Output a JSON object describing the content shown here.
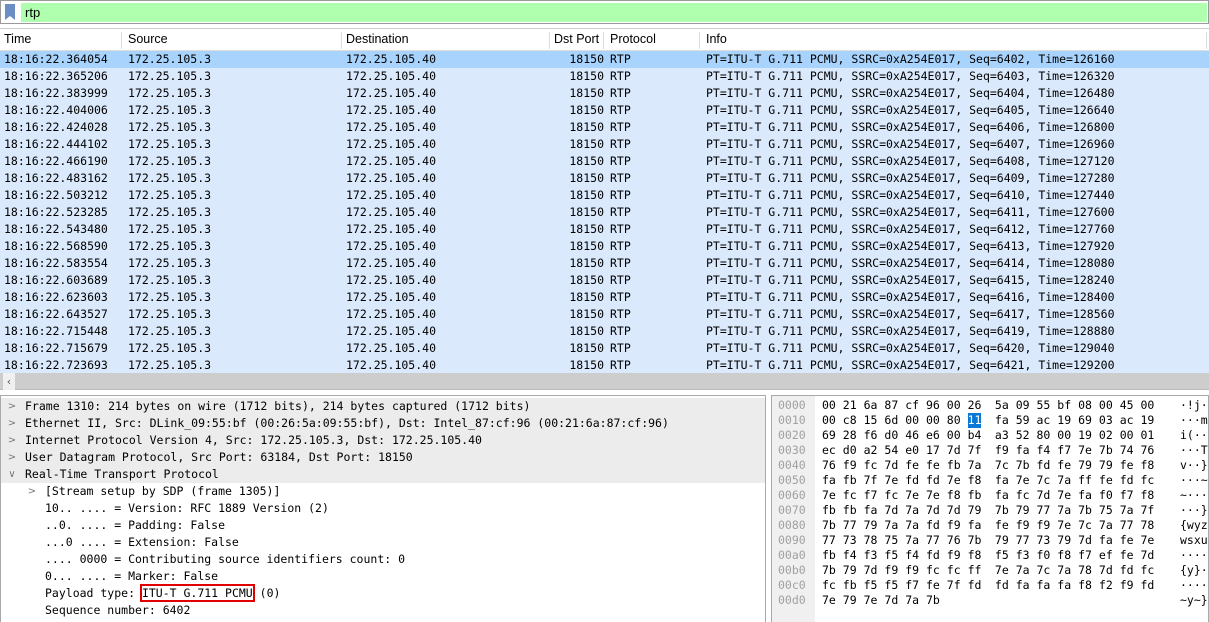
{
  "filter": {
    "value": "rtp"
  },
  "columns": [
    "Time",
    "Source",
    "Destination",
    "Dst Port",
    "Protocol",
    "Info"
  ],
  "packets": [
    [
      "18:16:22.364054",
      "172.25.105.3",
      "172.25.105.40",
      "18150",
      "RTP",
      "PT=ITU-T G.711 PCMU, SSRC=0xA254E017, Seq=6402, Time=126160"
    ],
    [
      "18:16:22.365206",
      "172.25.105.3",
      "172.25.105.40",
      "18150",
      "RTP",
      "PT=ITU-T G.711 PCMU, SSRC=0xA254E017, Seq=6403, Time=126320"
    ],
    [
      "18:16:22.383999",
      "172.25.105.3",
      "172.25.105.40",
      "18150",
      "RTP",
      "PT=ITU-T G.711 PCMU, SSRC=0xA254E017, Seq=6404, Time=126480"
    ],
    [
      "18:16:22.404006",
      "172.25.105.3",
      "172.25.105.40",
      "18150",
      "RTP",
      "PT=ITU-T G.711 PCMU, SSRC=0xA254E017, Seq=6405, Time=126640"
    ],
    [
      "18:16:22.424028",
      "172.25.105.3",
      "172.25.105.40",
      "18150",
      "RTP",
      "PT=ITU-T G.711 PCMU, SSRC=0xA254E017, Seq=6406, Time=126800"
    ],
    [
      "18:16:22.444102",
      "172.25.105.3",
      "172.25.105.40",
      "18150",
      "RTP",
      "PT=ITU-T G.711 PCMU, SSRC=0xA254E017, Seq=6407, Time=126960"
    ],
    [
      "18:16:22.466190",
      "172.25.105.3",
      "172.25.105.40",
      "18150",
      "RTP",
      "PT=ITU-T G.711 PCMU, SSRC=0xA254E017, Seq=6408, Time=127120"
    ],
    [
      "18:16:22.483162",
      "172.25.105.3",
      "172.25.105.40",
      "18150",
      "RTP",
      "PT=ITU-T G.711 PCMU, SSRC=0xA254E017, Seq=6409, Time=127280"
    ],
    [
      "18:16:22.503212",
      "172.25.105.3",
      "172.25.105.40",
      "18150",
      "RTP",
      "PT=ITU-T G.711 PCMU, SSRC=0xA254E017, Seq=6410, Time=127440"
    ],
    [
      "18:16:22.523285",
      "172.25.105.3",
      "172.25.105.40",
      "18150",
      "RTP",
      "PT=ITU-T G.711 PCMU, SSRC=0xA254E017, Seq=6411, Time=127600"
    ],
    [
      "18:16:22.543480",
      "172.25.105.3",
      "172.25.105.40",
      "18150",
      "RTP",
      "PT=ITU-T G.711 PCMU, SSRC=0xA254E017, Seq=6412, Time=127760"
    ],
    [
      "18:16:22.568590",
      "172.25.105.3",
      "172.25.105.40",
      "18150",
      "RTP",
      "PT=ITU-T G.711 PCMU, SSRC=0xA254E017, Seq=6413, Time=127920"
    ],
    [
      "18:16:22.583554",
      "172.25.105.3",
      "172.25.105.40",
      "18150",
      "RTP",
      "PT=ITU-T G.711 PCMU, SSRC=0xA254E017, Seq=6414, Time=128080"
    ],
    [
      "18:16:22.603689",
      "172.25.105.3",
      "172.25.105.40",
      "18150",
      "RTP",
      "PT=ITU-T G.711 PCMU, SSRC=0xA254E017, Seq=6415, Time=128240"
    ],
    [
      "18:16:22.623603",
      "172.25.105.3",
      "172.25.105.40",
      "18150",
      "RTP",
      "PT=ITU-T G.711 PCMU, SSRC=0xA254E017, Seq=6416, Time=128400"
    ],
    [
      "18:16:22.643527",
      "172.25.105.3",
      "172.25.105.40",
      "18150",
      "RTP",
      "PT=ITU-T G.711 PCMU, SSRC=0xA254E017, Seq=6417, Time=128560"
    ],
    [
      "18:16:22.715448",
      "172.25.105.3",
      "172.25.105.40",
      "18150",
      "RTP",
      "PT=ITU-T G.711 PCMU, SSRC=0xA254E017, Seq=6419, Time=128880"
    ],
    [
      "18:16:22.715679",
      "172.25.105.3",
      "172.25.105.40",
      "18150",
      "RTP",
      "PT=ITU-T G.711 PCMU, SSRC=0xA254E017, Seq=6420, Time=129040"
    ],
    [
      "18:16:22.723693",
      "172.25.105.3",
      "172.25.105.40",
      "18150",
      "RTP",
      "PT=ITU-T G.711 PCMU, SSRC=0xA254E017, Seq=6421, Time=129200"
    ]
  ],
  "selected_packet": 0,
  "details": [
    {
      "level": 0,
      "toggle": "collapsed",
      "text": "Frame 1310: 214 bytes on wire (1712 bits), 214 bytes captured (1712 bits)"
    },
    {
      "level": 0,
      "toggle": "collapsed",
      "text": "Ethernet II, Src: DLink_09:55:bf (00:26:5a:09:55:bf), Dst: Intel_87:cf:96 (00:21:6a:87:cf:96)"
    },
    {
      "level": 0,
      "toggle": "collapsed",
      "text": "Internet Protocol Version 4, Src: 172.25.105.3, Dst: 172.25.105.40"
    },
    {
      "level": 0,
      "toggle": "collapsed",
      "text": "User Datagram Protocol, Src Port: 63184, Dst Port: 18150"
    },
    {
      "level": 0,
      "toggle": "expanded",
      "text": "Real-Time Transport Protocol"
    },
    {
      "level": 1,
      "toggle": "collapsed",
      "text": "[Stream setup by SDP (frame 1305)]"
    },
    {
      "level": 1,
      "toggle": "",
      "text": "10.. .... = Version: RFC 1889 Version (2)"
    },
    {
      "level": 1,
      "toggle": "",
      "text": "..0. .... = Padding: False"
    },
    {
      "level": 1,
      "toggle": "",
      "text": "...0 .... = Extension: False"
    },
    {
      "level": 1,
      "toggle": "",
      "text": ".... 0000 = Contributing source identifiers count: 0"
    },
    {
      "level": 1,
      "toggle": "",
      "text": "0... .... = Marker: False"
    },
    {
      "level": 1,
      "toggle": "",
      "text": "Payload type: ",
      "highlight": "ITU-T G.711 PCMU",
      "after": " (0)"
    },
    {
      "level": 1,
      "toggle": "",
      "text": "Sequence number: 6402"
    }
  ],
  "hex": [
    {
      "offset": "0000",
      "bytes": "00 21 6a 87 cf 96 00 26 5a 09 55 bf 08 00 45 00",
      "ascii": "·!j··"
    },
    {
      "offset": "0010",
      "bytes": "00 c8 15 6d 00 00 80 11 fa 59 ac 19 69 03 ac 19",
      "ascii": "···m·"
    },
    {
      "offset": "0020",
      "bytes": "69 28 f6 d0 46 e6 00 b4 a3 52 80 00 19 02 00 01",
      "ascii": "i(··F"
    },
    {
      "offset": "0030",
      "bytes": "ec d0 a2 54 e0 17 7d 7f f9 fa f4 f7 7e 7b 74 76",
      "ascii": "···T·"
    },
    {
      "offset": "0040",
      "bytes": "76 f9 fc 7d fe fe fb 7a 7c 7b fd fe 79 79 fe f8",
      "ascii": "v··}·"
    },
    {
      "offset": "0050",
      "bytes": "fa fb 7f 7e fd fd 7e f8 fa 7e 7c 7a ff fe fd fc",
      "ascii": "···~·"
    },
    {
      "offset": "0060",
      "bytes": "7e fc f7 fc 7e 7e f8 fb fa fc 7d 7e fa f0 f7 f8",
      "ascii": "~···~"
    },
    {
      "offset": "0070",
      "bytes": "fb fb fa 7d 7a 7d 7d 79 7b 79 77 7a 7b 75 7a 7f",
      "ascii": "···}z"
    },
    {
      "offset": "0080",
      "bytes": "7b 77 79 7a 7a fd f9 fa fe f9 f9 7e 7c 7a 77 78",
      "ascii": "{wyzz"
    },
    {
      "offset": "0090",
      "bytes": "77 73 78 75 7a 77 76 7b 79 77 73 79 7d fa fe 7e",
      "ascii": "wsxuz"
    },
    {
      "offset": "00a0",
      "bytes": "fb f4 f3 f5 f4 fd f9 f8 f5 f3 f0 f8 f7 ef fe 7d",
      "ascii": "·····"
    },
    {
      "offset": "00b0",
      "bytes": "7b 79 7d f9 f9 fc fc ff 7e 7a 7c 7a 78 7d fd fc",
      "ascii": "{y}··"
    },
    {
      "offset": "00c0",
      "bytes": "fc fb f5 f5 f7 fe 7f fd fd fa fa fa f8 f2 f9 fd",
      "ascii": "·····"
    },
    {
      "offset": "00d0",
      "bytes": "7e 79 7e 7d 7a 7b",
      "ascii": "~y~}z"
    }
  ],
  "selected_byte": {
    "row": 1,
    "index": 7
  },
  "colors": {
    "filter_valid": "#afffaf",
    "row_rtp": "#dae9fb",
    "row_selected": "#a8d3fc",
    "byte_selected": "#0a78d7",
    "highlight_box": "#e00000"
  }
}
